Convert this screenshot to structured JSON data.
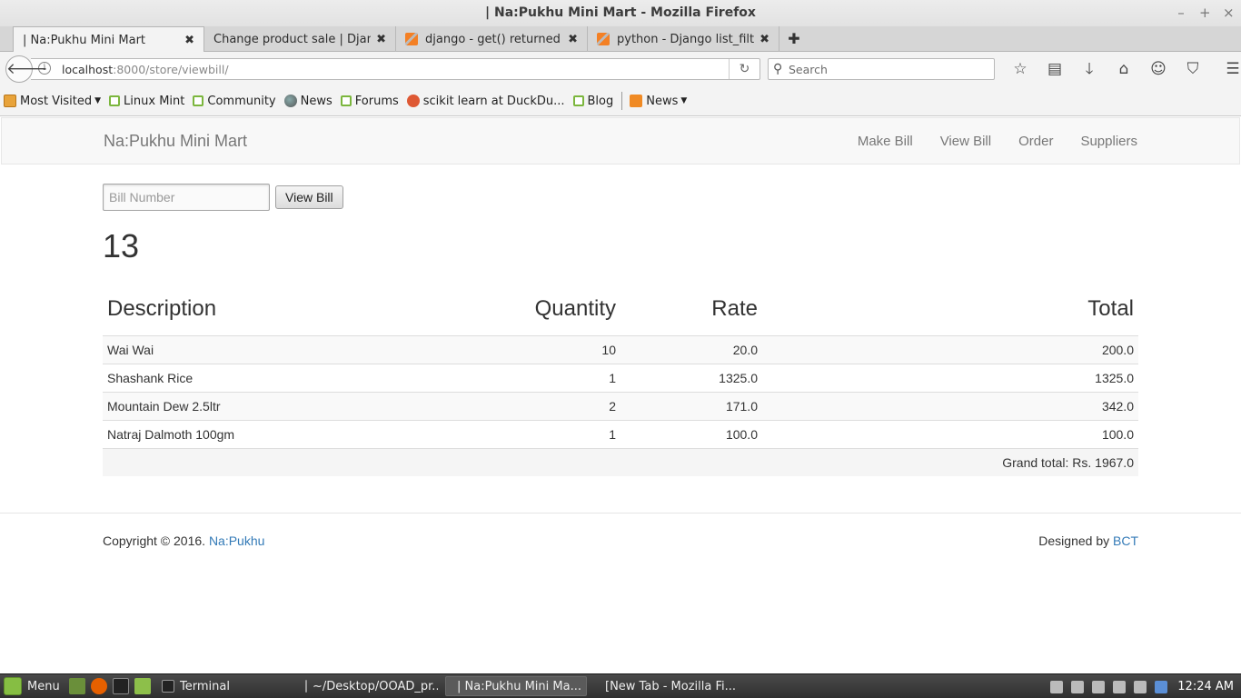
{
  "window": {
    "title": "| Na:Pukhu Mini Mart - Mozilla Firefox",
    "controls": [
      "–",
      "+",
      "×"
    ]
  },
  "tabs": [
    {
      "label": "| Na:Pukhu Mini Mart",
      "active": true
    },
    {
      "label": "Change product sale | Djang…",
      "active": false
    },
    {
      "label": "django - get() returned m…",
      "active": false
    },
    {
      "label": "python - Django list_filter …",
      "active": false
    }
  ],
  "navbar": {
    "url_host": "localhost",
    "url_rest": ":8000/store/viewbill/",
    "search_placeholder": "Search"
  },
  "bookmarks": [
    {
      "label": "Most Visited",
      "icon": "folder-icon",
      "dropdown": true
    },
    {
      "label": "Linux Mint",
      "icon": "mint-icon"
    },
    {
      "label": "Community",
      "icon": "mint-icon"
    },
    {
      "label": "News",
      "icon": "globe-icon"
    },
    {
      "label": "Forums",
      "icon": "mint-icon"
    },
    {
      "label": "scikit learn at DuckDu...",
      "icon": "duckduckgo-icon"
    },
    {
      "label": "Blog",
      "icon": "mint-icon"
    },
    {
      "label": "News",
      "icon": "rss-icon",
      "dropdown": true
    }
  ],
  "site": {
    "brand": "Na:Pukhu Mini Mart",
    "nav": [
      "Make Bill",
      "View Bill",
      "Order",
      "Suppliers"
    ],
    "form": {
      "placeholder": "Bill Number",
      "button": "View Bill"
    },
    "bill_number": "13",
    "table": {
      "headers": [
        "Description",
        "Quantity",
        "Rate",
        "Total"
      ],
      "rows": [
        [
          "Wai Wai",
          "10",
          "20.0",
          "200.0"
        ],
        [
          "Shashank Rice",
          "1",
          "1325.0",
          "1325.0"
        ],
        [
          "Mountain Dew 2.5ltr",
          "2",
          "171.0",
          "342.0"
        ],
        [
          "Natraj Dalmoth 100gm",
          "1",
          "100.0",
          "100.0"
        ]
      ],
      "grand_total": "Grand total: Rs. 1967.0"
    },
    "footer": {
      "copyright": "Copyright © 2016.",
      "copyright_link": "Na:Pukhu",
      "designed": "Designed by",
      "designed_link": "BCT"
    }
  },
  "taskbar": {
    "menu": "Menu",
    "tasks": [
      {
        "label": "Terminal",
        "active": false
      },
      {
        "label": "~/Desktop/OOAD_pr...",
        "active": false
      },
      {
        "label": "| Na:Pukhu Mini Ma...",
        "active": true
      },
      {
        "label": "[New Tab - Mozilla Fi...",
        "active": false
      }
    ],
    "clock": "12:24 AM"
  },
  "colors": {
    "link": "#337ab7",
    "navbar_bg": "#f8f8f8",
    "taskbar_bg": "#3a3a3a"
  }
}
